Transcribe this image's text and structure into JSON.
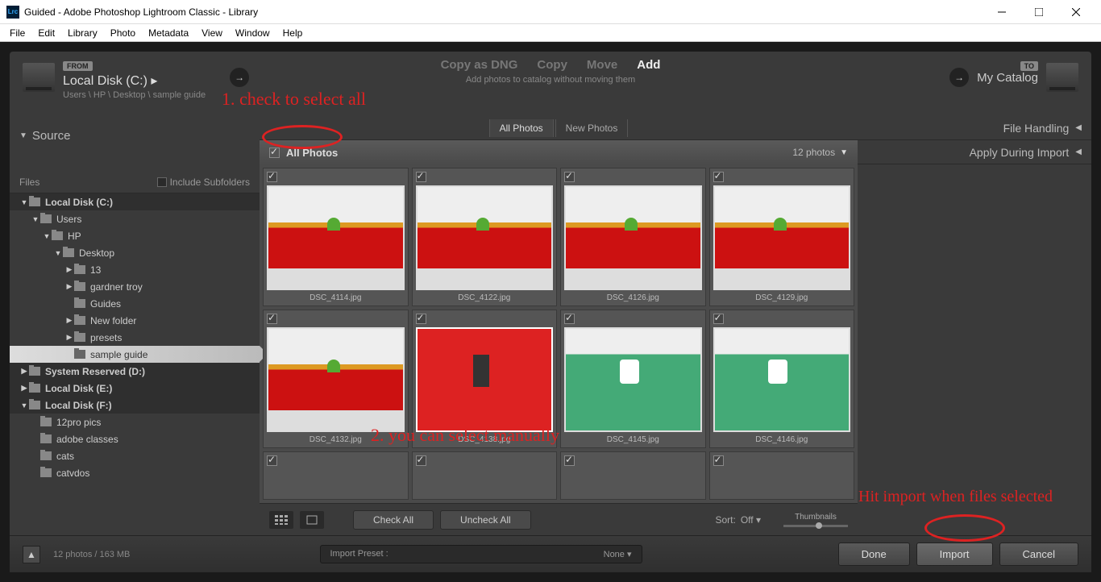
{
  "window": {
    "logo": "Lrc",
    "title": "Guided - Adobe Photoshop Lightroom Classic - Library"
  },
  "menu": [
    "File",
    "Edit",
    "Library",
    "Photo",
    "Metadata",
    "View",
    "Window",
    "Help"
  ],
  "from": {
    "badge": "FROM",
    "source": "Local Disk (C:)  ▸",
    "path": "Users \\ HP \\ Desktop \\ sample guide"
  },
  "actions": {
    "items": [
      "Copy as DNG",
      "Copy",
      "Move",
      "Add"
    ],
    "active": 3,
    "subtext": "Add photos to catalog without moving them"
  },
  "to": {
    "badge": "TO",
    "label": "My Catalog"
  },
  "tabs": {
    "items": [
      "All Photos",
      "New Photos"
    ],
    "active": 0
  },
  "gridhead": {
    "label": "All Photos",
    "count": "12 photos"
  },
  "left": {
    "source": "Source",
    "files": "Files",
    "include": "Include Subfolders",
    "tree": [
      {
        "label": "Local Disk (C:)",
        "type": "disk",
        "depth": 0,
        "open": true
      },
      {
        "label": "Users",
        "type": "folder",
        "depth": 1,
        "open": true
      },
      {
        "label": "HP",
        "type": "folder",
        "depth": 2,
        "open": true
      },
      {
        "label": "Desktop",
        "type": "folder",
        "depth": 3,
        "open": true
      },
      {
        "label": "13",
        "type": "folder",
        "depth": 4,
        "closed": true
      },
      {
        "label": "gardner troy",
        "type": "folder",
        "depth": 4,
        "closed": true
      },
      {
        "label": "Guides",
        "type": "folder",
        "depth": 4
      },
      {
        "label": "New folder",
        "type": "folder",
        "depth": 4,
        "closed": true
      },
      {
        "label": "presets",
        "type": "folder",
        "depth": 4,
        "closed": true
      },
      {
        "label": "sample guide",
        "type": "folder",
        "depth": 4,
        "selected": true
      },
      {
        "label": "System Reserved (D:)",
        "type": "disk",
        "depth": 0,
        "closed": true
      },
      {
        "label": "Local Disk (E:)",
        "type": "disk",
        "depth": 0,
        "closed": true
      },
      {
        "label": "Local Disk (F:)",
        "type": "disk",
        "depth": 0,
        "open": true
      },
      {
        "label": "12pro pics",
        "type": "folder",
        "depth": 1
      },
      {
        "label": "adobe classes",
        "type": "folder",
        "depth": 1
      },
      {
        "label": "cats",
        "type": "folder",
        "depth": 1
      },
      {
        "label": "catvdos",
        "type": "folder",
        "depth": 1
      }
    ]
  },
  "photos": [
    {
      "name": "DSC_4114.jpg",
      "style": "red"
    },
    {
      "name": "DSC_4122.jpg",
      "style": "red"
    },
    {
      "name": "DSC_4126.jpg",
      "style": "red"
    },
    {
      "name": "DSC_4129.jpg",
      "style": "red"
    },
    {
      "name": "DSC_4132.jpg",
      "style": "red"
    },
    {
      "name": "DSC_4138.jpg",
      "style": "solid",
      "sel": true
    },
    {
      "name": "DSC_4145.jpg",
      "style": "green"
    },
    {
      "name": "DSC_4146.jpg",
      "style": "green"
    },
    {
      "name": "",
      "style": "empty"
    },
    {
      "name": "",
      "style": "empty"
    },
    {
      "name": "",
      "style": "empty"
    },
    {
      "name": "",
      "style": "empty"
    }
  ],
  "toolbar": {
    "checkall": "Check All",
    "uncheckall": "Uncheck All",
    "sort": "Sort:",
    "sortval": "Off  ▾",
    "thumbs": "Thumbnails"
  },
  "right": {
    "handling": "File Handling",
    "apply": "Apply During Import"
  },
  "footer": {
    "stats": "12 photos / 163 MB",
    "preset": "Import Preset :",
    "presetval": "None ▾",
    "done": "Done",
    "import": "Import",
    "cancel": "Cancel"
  },
  "annotations": {
    "a1": "1. check to select all",
    "a2": "2. you can select manually",
    "a3": "Hit import when files selected"
  }
}
